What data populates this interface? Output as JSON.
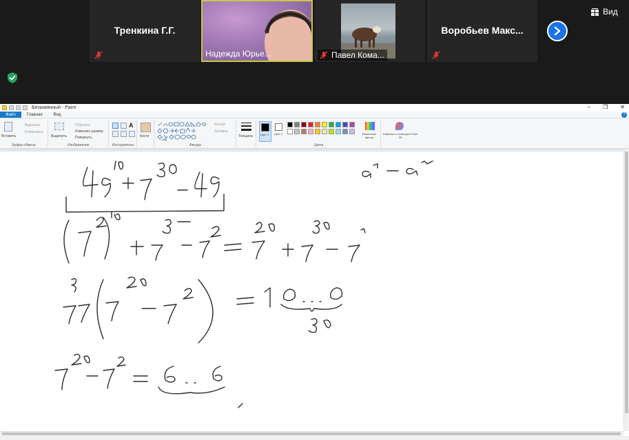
{
  "zoom": {
    "participants": [
      {
        "name": "Тренкина Г.Г.",
        "muted": true
      },
      {
        "name": "Надежда Юрье...",
        "muted": false,
        "active_speaker": true
      },
      {
        "name": "Павел Кома...",
        "muted": true
      },
      {
        "name": "Воробьев  Макс...",
        "muted": true
      }
    ],
    "view_label": "Вид",
    "icons": {
      "next": "chevron-right-icon",
      "view": "grid-view-icon",
      "security": "shield-check-icon",
      "mute": "microphone-muted-icon"
    },
    "colors": {
      "active_border": "#c9c64a",
      "next_button": "#1a73e8",
      "shield": "#23a45d",
      "mute": "#e0383c"
    }
  },
  "paint": {
    "window_title": "Безымянный - Paint",
    "tabs": [
      "Файл",
      "Главная",
      "Вид"
    ],
    "groups": {
      "clipboard": {
        "label": "Буфер обмена",
        "paste": "Вставить",
        "cut": "Вырезать",
        "copy": "Копировать"
      },
      "image": {
        "label": "Изображение",
        "select": "Выделить",
        "crop": "Обрезать",
        "resize": "Изменить размер",
        "rotate": "Повернуть"
      },
      "tools": {
        "label": "Инструменты"
      },
      "brushes": {
        "label": "Кисти"
      },
      "shapes": {
        "label": "Фигуры",
        "outline": "Контур",
        "fill": "Заливка"
      },
      "size": {
        "label": "Толщина"
      },
      "colors": {
        "label": "Цвета",
        "color1": "Цвет 1",
        "color2": "Цвет 2",
        "edit_colors": "Изменение цветов",
        "paint3d": "Изменить с помощью Paint 3D"
      }
    },
    "palette": [
      "#000000",
      "#7f7f7f",
      "#880015",
      "#ed1c24",
      "#ff7f27",
      "#fff200",
      "#22b14c",
      "#00a2e8",
      "#3f48cc",
      "#a349a4",
      "#ffffff",
      "#c3c3c3",
      "#b97a57",
      "#ffaec9",
      "#ffc90e",
      "#efe4b0",
      "#b5e61d",
      "#99d9ea",
      "#7092be",
      "#c8bfe7"
    ]
  }
}
